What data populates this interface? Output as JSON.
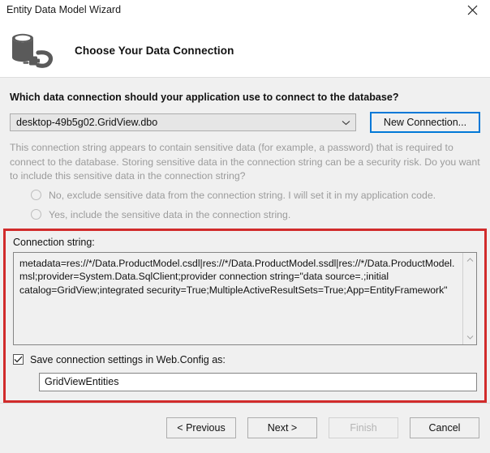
{
  "window": {
    "title": "Entity Data Model Wizard",
    "close_label": "✕"
  },
  "header": {
    "title": "Choose Your Data Connection",
    "icon": "database-plug-icon"
  },
  "main": {
    "question": "Which data connection should your application use to connect to the database?",
    "connection_combo": {
      "value": "desktop-49b5g02.GridView.dbo",
      "chevron": "chevron-down-icon"
    },
    "new_connection_button": "New Connection...",
    "sensitive_note": "This connection string appears to contain sensitive data (for example, a password) that is required to connect to the database. Storing sensitive data in the connection string can be a security risk. Do you want to include this sensitive data in the connection string?",
    "radios": [
      {
        "label": "No, exclude sensitive data from the connection string. I will set it in my application code.",
        "selected": false,
        "disabled": true
      },
      {
        "label": "Yes, include the sensitive data in the connection string.",
        "selected": false,
        "disabled": true
      }
    ],
    "connection_string_label": "Connection string:",
    "connection_string_value": "metadata=res://*/Data.ProductModel.csdl|res://*/Data.ProductModel.ssdl|res://*/Data.ProductModel.msl;provider=System.Data.SqlClient;provider connection string=\"data source=.;initial catalog=GridView;integrated security=True;MultipleActiveResultSets=True;App=EntityFramework\"",
    "save_checkbox": {
      "label": "Save connection settings in Web.Config as:",
      "checked": true
    },
    "entity_name_value": "GridViewEntities",
    "highlight_color": "#d12b2b"
  },
  "footer": {
    "buttons": [
      {
        "label": "< Previous",
        "disabled": false
      },
      {
        "label": "Next >",
        "disabled": false
      },
      {
        "label": "Finish",
        "disabled": true
      },
      {
        "label": "Cancel",
        "disabled": false
      }
    ]
  }
}
